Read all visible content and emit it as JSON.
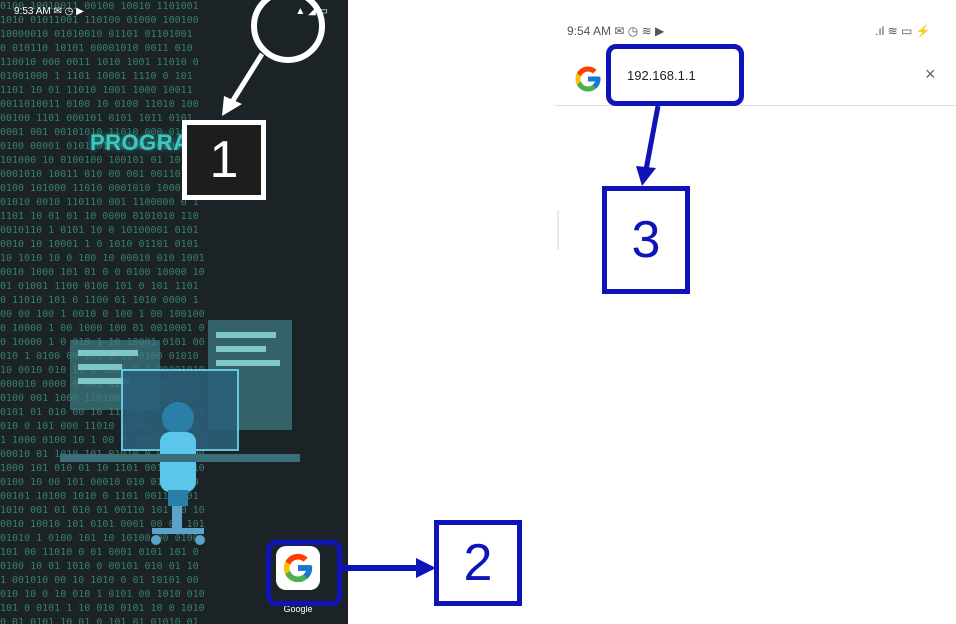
{
  "left_screen": {
    "status_time": "9:53 AM",
    "status_icons_left": "✉ ◷ ▶",
    "status_icons_right": "▲ ◢ ▭",
    "wallpaper_title": "PROGRAMMER",
    "matrix_lines": [
      "0100 10010011 00100 10010 1101001",
      "1010 01011001 110100 01000 100100",
      "10000010 01010010 01101 01101001",
      "0 010110 10101 00001010 0011 010",
      "110010 000 0011 1010 1001 11010 0",
      "01001000 1 1101 10001 1110 0 101",
      "1101 10 01 11010 1001 1000 10011",
      "0011010011 0100 10 0100 11010 100",
      "00100 1101 000101 0101 1011 0101",
      "0001 001 00101010 11010 000 0100",
      "0100 00001 0101101 001001 01000 1",
      "101000 10 0100100 100101 01 10 01",
      "0001010 10011 010 00 001 0011010",
      "0100 101000 11010 0001010 10001 1",
      "01010 0010 110110 001 1100000 0 1",
      "1101 10 01 01 10 0000 0101010 110",
      "0010110 1 0101 10 0 10100001 0101",
      "0010 10 10001 1 0 1010 01101 0101",
      "10 1010 10 0 100 10 00010 010 1001",
      "0010 1000 101 01 0 0 0100 10000 10",
      "01 01001 1100 0100 101 0 101 1101",
      "0 11010 101 0 1100 01 1010 0000 1",
      "00 00 100 1 0010 0 100 1 00 100100",
      "0 10000 1 00 1000 100 01 0010001 0",
      "0 10000 1 0 010 1 10 10001 0101 00",
      "010 1 0100 00 100 1 11 0100 01010",
      "10 0010 010 11 0 1001 0 1 00001010",
      "000010 0000 0 001 010 10 01011010",
      "0100 001 1000 11010000 0010 10010",
      "0101 01 010 00 10 11 010 1101 0 01",
      "010 0 101 000 11010 01000 1010 01",
      "1 1000 0100 10 1 00 0 1001 10101 1",
      "00010 01 1010 101 01010 0 001 1000",
      "1000 101 010 01 10 1101 00100 1010",
      "0100 10 00 101 00010 010 01101 00",
      "00101 10100 1010 0 1101 0011 0101",
      "1010 001 01 010 01 00110 101 10 10",
      "0010 10010 101 0101 0001 00 01 101",
      "01010 1 0100 101 10 10100 00 0100",
      "101 00 11010 0 01 0001 0101 101 0",
      "0100 10 01 1010 0 00101 010 01 10",
      "1 001010 00 10 1010 0 01 10101 00",
      "010 10 0 10 010 1 0101 00 1010 010",
      "101 0 0101 1 10 010 0101 10 0 1010",
      "0 01 0101 10 01 0 101 01 01010 01"
    ],
    "google_app_label": "Google"
  },
  "right_screen": {
    "status_time": "9:54 AM",
    "status_icons_left": "✉ ◷ ≋ ▶",
    "status_icons_right": ".ıl ≋ ▭ ⚡",
    "search_url": "192.168.1.1",
    "clear_glyph": "×"
  },
  "annotations": {
    "step1": "1",
    "step2": "2",
    "step3": "3"
  },
  "colors": {
    "annotation_blue": "#0f14b8",
    "annotation_white": "#ffffff",
    "matrix_green": "#3b8f78",
    "title_cyan": "#39c9c0"
  }
}
